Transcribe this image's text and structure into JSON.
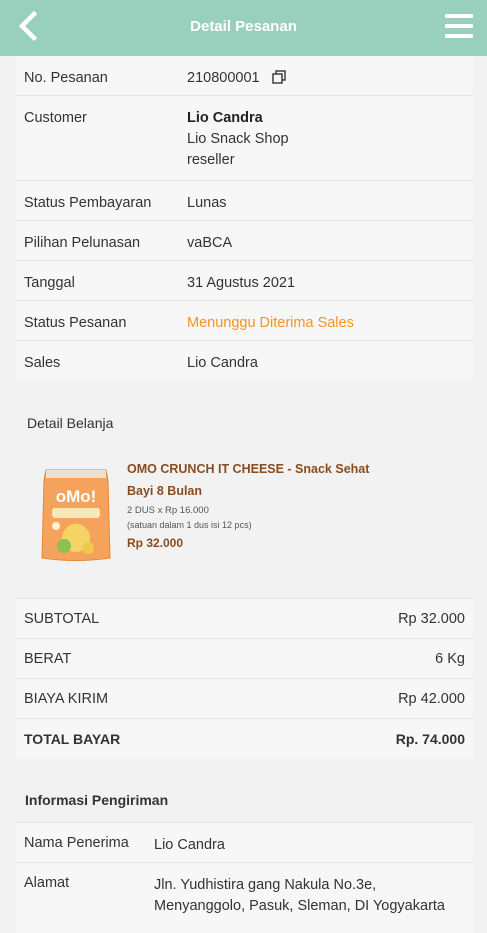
{
  "header": {
    "title": "Detail Pesanan"
  },
  "order": {
    "no_label": "No. Pesanan",
    "no_value": "210800001",
    "customer_label": "Customer",
    "customer_name": "Lio Candra",
    "customer_shop": "Lio Snack Shop",
    "customer_type": "reseller",
    "payment_status_label": "Status Pembayaran",
    "payment_status_value": "Lunas",
    "settlement_label": "Pilihan Pelunasan",
    "settlement_value": "vaBCA",
    "date_label": "Tanggal",
    "date_value": "31 Agustus 2021",
    "order_status_label": "Status Pesanan",
    "order_status_value": "Menunggu Diterima Sales",
    "sales_label": "Sales",
    "sales_value": "Lio Candra"
  },
  "detail": {
    "title": "Detail Belanja",
    "product": {
      "name_line1": "OMO CRUNCH IT CHEESE - Snack Sehat",
      "name_line2": "Bayi 8 Bulan",
      "qty": "2 DUS x Rp 16.000",
      "note": "(satuan dalam 1 dus isi 12 pcs)",
      "price": "Rp 32.000",
      "image_brand": "oMo!"
    }
  },
  "summary": {
    "subtotal_label": "SUBTOTAL",
    "subtotal_value": "Rp 32.000",
    "weight_label": "BERAT",
    "weight_value": "6 Kg",
    "shipping_label": "BIAYA KIRIM",
    "shipping_value": "Rp 42.000",
    "total_label": "TOTAL BAYAR",
    "total_value": "Rp. 74.000"
  },
  "shipping": {
    "title": "Informasi Pengiriman",
    "recipient_label": "Nama Penerima",
    "recipient_value": "Lio Candra",
    "address_label": "Alamat",
    "address_line1": "Jln. Yudhistira gang Nakula No.3e,",
    "address_line2": "Menyanggolo, Pasuk, Sleman, DI Yogyakarta"
  },
  "colors": {
    "header": "#99cfbd",
    "status_orange": "#f7941d",
    "product_brown": "#8a4b1f"
  }
}
